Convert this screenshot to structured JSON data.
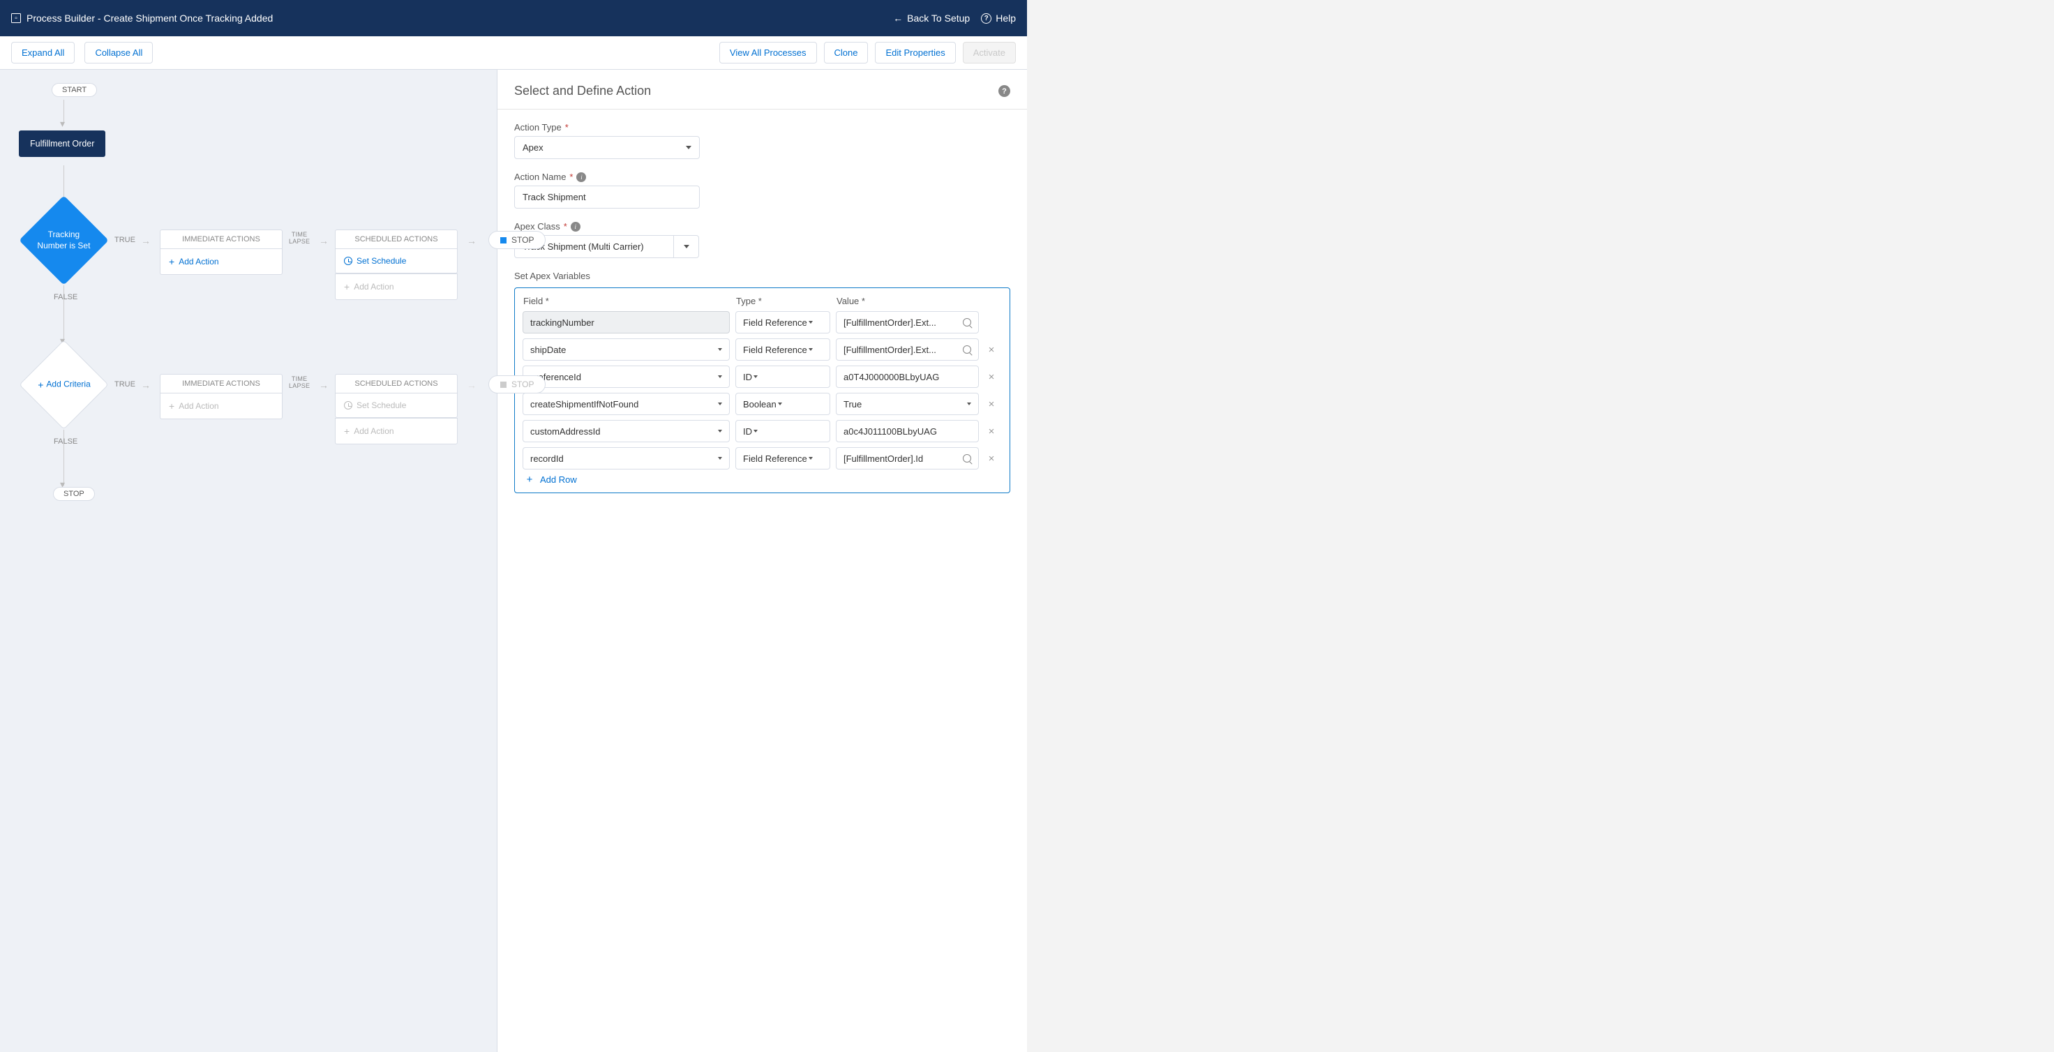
{
  "topbar": {
    "title": "Process Builder - Create Shipment Once Tracking Added",
    "back": "Back To Setup",
    "help": "Help"
  },
  "toolbar": {
    "expand": "Expand All",
    "collapse": "Collapse All",
    "viewAll": "View All Processes",
    "clone": "Clone",
    "editProps": "Edit Properties",
    "activate": "Activate"
  },
  "canvas": {
    "start": "START",
    "object": "Fulfillment Order",
    "criteria1": "Tracking Number is Set",
    "criteria2": "Add Criteria",
    "trueLabel": "TRUE",
    "falseLabel": "FALSE",
    "immediate": "IMMEDIATE ACTIONS",
    "scheduled": "SCHEDULED ACTIONS",
    "timeLapse": "TIME\nLAPSE",
    "addAction": "Add Action",
    "setSchedule": "Set Schedule",
    "stop": "STOP"
  },
  "panel": {
    "title": "Select and Define Action",
    "actionTypeLabel": "Action Type",
    "actionType": "Apex",
    "actionNameLabel": "Action Name",
    "actionName": "Track Shipment",
    "apexClassLabel": "Apex Class",
    "apexClass": "Track Shipment (Multi Carrier)",
    "setVarsLabel": "Set Apex Variables",
    "headers": {
      "field": "Field",
      "type": "Type",
      "value": "Value"
    },
    "rows": [
      {
        "field": "trackingNumber",
        "type": "Field Reference",
        "value": "[FulfillmentOrder].Ext...",
        "locked": true,
        "typeCaret": true,
        "valueSearch": true,
        "valueCaret": false,
        "deletable": false
      },
      {
        "field": "shipDate",
        "type": "Field Reference",
        "value": "[FulfillmentOrder].Ext...",
        "locked": false,
        "typeCaret": true,
        "valueSearch": true,
        "valueCaret": false,
        "deletable": true
      },
      {
        "field": "preferenceId",
        "type": "ID",
        "value": "a0T4J000000BLbyUAG",
        "locked": false,
        "typeCaret": true,
        "valueSearch": false,
        "valueCaret": false,
        "deletable": true
      },
      {
        "field": "createShipmentIfNotFound",
        "type": "Boolean",
        "value": "True",
        "locked": false,
        "typeCaret": true,
        "valueSearch": false,
        "valueCaret": true,
        "deletable": true
      },
      {
        "field": "customAddressId",
        "type": "ID",
        "value": "a0c4J011100BLbyUAG",
        "locked": false,
        "typeCaret": true,
        "valueSearch": false,
        "valueCaret": false,
        "deletable": true
      },
      {
        "field": "recordId",
        "type": "Field Reference",
        "value": "[FulfillmentOrder].Id",
        "locked": false,
        "typeCaret": true,
        "valueSearch": true,
        "valueCaret": false,
        "deletable": true
      }
    ],
    "addRow": "Add Row"
  }
}
